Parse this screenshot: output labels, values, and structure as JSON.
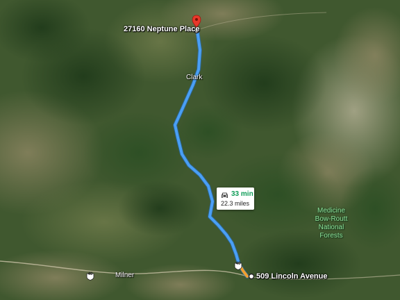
{
  "map": {
    "origin_label": "27160 Neptune Place",
    "destination_label": "509 Lincoln Avenue",
    "places": {
      "clark": "Clark",
      "milner": "Milner"
    },
    "forest_label": "Medicine Bow-Routt National Forests",
    "route": {
      "time": "33 min",
      "distance": "22.3 miles"
    },
    "highway_shields": [
      "40",
      "40"
    ],
    "colors": {
      "route": "#4a9ff5",
      "time": "#0f9d58",
      "pin": "#e8382a",
      "forest_text": "#8fe39a"
    }
  }
}
